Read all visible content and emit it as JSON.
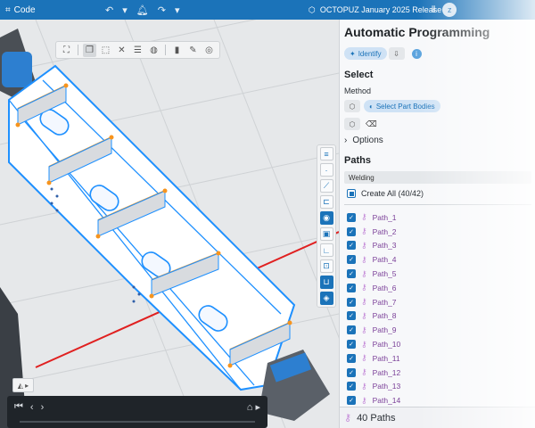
{
  "titlebar": {
    "app_label": "Code",
    "release": "OCTOPUZ January 2025 Release",
    "avatar_letter": "z"
  },
  "panel": {
    "title": "Automatic Programming",
    "identify_label": "Identify",
    "select_header": "Select",
    "method_label": "Method",
    "select_bodies_label": "Select Part Bodies",
    "options_label": "Options",
    "paths_header": "Paths",
    "process_dropdown": "Welding",
    "create_all": "Create All (40/42)",
    "footer_count": "40 Paths"
  },
  "paths": [
    "Path_1",
    "Path_2",
    "Path_3",
    "Path_4",
    "Path_5",
    "Path_6",
    "Path_7",
    "Path_8",
    "Path_9",
    "Path_10",
    "Path_11",
    "Path_12",
    "Path_13",
    "Path_14"
  ],
  "colors": {
    "accent": "#1b73b9",
    "model_outline": "#1e90ff",
    "path_highlight": "#f7941d",
    "axis_red": "#e02020"
  }
}
